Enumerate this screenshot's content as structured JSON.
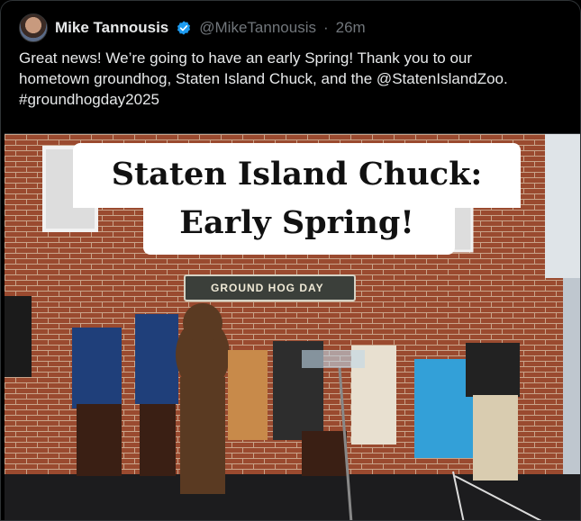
{
  "post": {
    "author_name": "Mike Tannousis",
    "handle": "@MikeTannousis",
    "separator": "·",
    "timestamp": "26m",
    "text_lines": [
      "Great news! We’re going to have an early Spring! Thank you to our",
      "hometown groundhog, Staten Island Chuck, and the @StatenIslandZoo.",
      "#groundhogday2025"
    ]
  },
  "image": {
    "overlay_line1": "Staten Island Chuck:",
    "overlay_line2": "Early Spring!",
    "sign_text": "GROUND HOG DAY"
  },
  "colors": {
    "background": "#000000",
    "verified_badge": "#1d9bf0",
    "text": "#e7e9ea",
    "muted": "#71767b",
    "brick": "#9a4a2f"
  }
}
